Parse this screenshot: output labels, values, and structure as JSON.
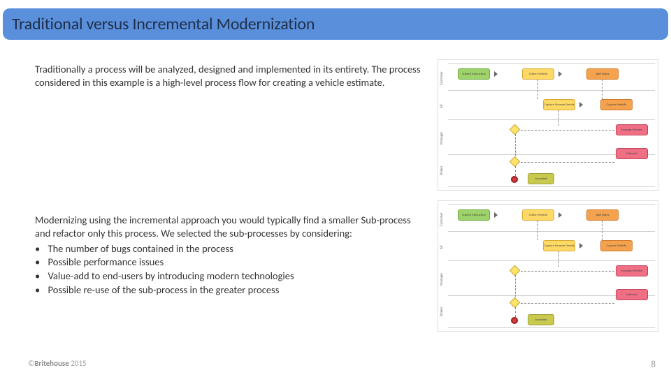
{
  "title": "Traditional versus Incremental Modernization",
  "para1": "Traditionally a process will be analyzed, designed and implemented in its entirety.  The process considered in this example is a high-level process flow for creating a vehicle estimate.",
  "para2": "Modernizing using the incremental approach you would typically find a smaller Sub-process and refactor only this process.  We selected the sub-processes by considering:",
  "bullets": [
    "The number of bugs contained in the process",
    "Possible performance issues",
    "Value-add to end-users by introducing modern technologies",
    "Possible re-use of the sub-process in the greater process"
  ],
  "footer": {
    "copy": "©",
    "brand": "Britehouse",
    "year": "2015"
  },
  "page_number": "8",
  "diagram": {
    "lanes": [
      "Customer",
      "AP",
      "Manager",
      "Broker"
    ],
    "nodes_top": [
      "Submit Instruction",
      "Collect Vehicle",
      "Add Notes"
    ],
    "nodes_mid": [
      "Capture Finance Details",
      "Capture Vehicle"
    ],
    "nodes_mgr": [
      "Manager Review"
    ],
    "nodes_brk": [
      "Estimate",
      "Accepted"
    ]
  }
}
